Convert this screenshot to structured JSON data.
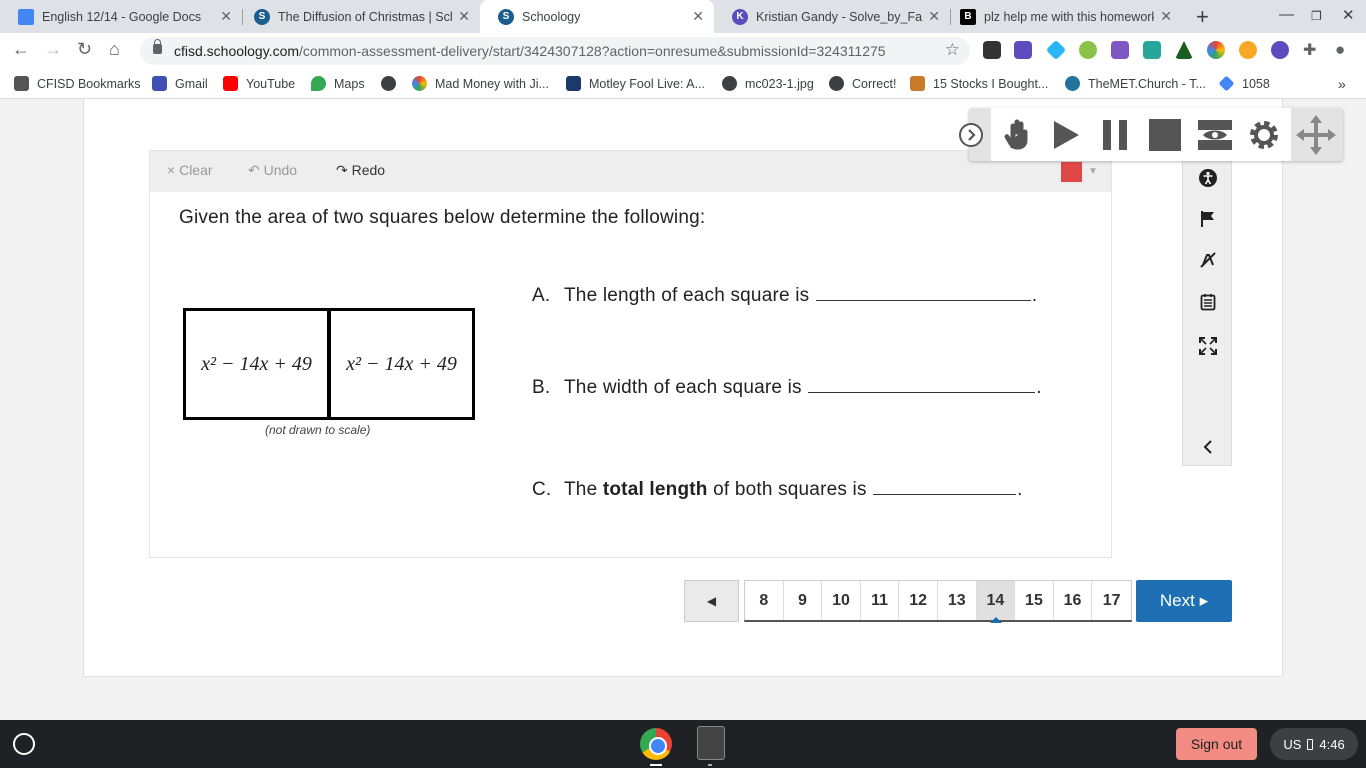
{
  "browser": {
    "tabs": [
      {
        "title": "English 12/14 - Google Docs",
        "favicon": "docs-icon",
        "color": "#4285f4"
      },
      {
        "title": "The Diffusion of Christmas | Sch",
        "favicon": "schoology-icon",
        "color": "#1a5e8f"
      },
      {
        "title": "Schoology",
        "favicon": "schoology-icon",
        "color": "#1a5e8f"
      },
      {
        "title": "Kristian Gandy - Solve_by_Facto",
        "favicon": "kami-icon",
        "color": "#5b4dbd"
      },
      {
        "title": "plz help me with this homework",
        "favicon": "brainly-icon",
        "color": "#000000"
      }
    ],
    "url_host": "cfisd.schoology.com",
    "url_path": "/common-assessment-delivery/start/3424307128?action=onresume&submissionId=324311275",
    "bookmarks": [
      "CFISD Bookmarks",
      "Gmail",
      "YouTube",
      "Maps",
      "Mad Money with Ji...",
      "Motley Fool Live: A...",
      "mc023-1.jpg",
      "Correct!",
      "15 Stocks I Bought...",
      "TheMET.Church - T...",
      "1058"
    ]
  },
  "question": {
    "toolbar": {
      "clear": "Clear",
      "undo": "Undo",
      "redo": "Redo"
    },
    "prompt": "Given the area of two squares below determine the following:",
    "square_expr": "x² − 14x + 49",
    "caption": "(not drawn to scale)",
    "items": [
      {
        "letter": "A.",
        "text": "The length of each square is"
      },
      {
        "letter": "B.",
        "text": "The width of each square is"
      },
      {
        "letter": "C.",
        "text_before": "The",
        "bold": "total length",
        "text_after": "of both squares is"
      }
    ]
  },
  "pager": {
    "prev": "◀",
    "pages": [
      "8",
      "9",
      "10",
      "11",
      "12",
      "13",
      "14",
      "15",
      "16",
      "17"
    ],
    "current": "14",
    "next": "Next ▸"
  },
  "shelf": {
    "signout": "Sign out",
    "locale": "US",
    "time": "4:46"
  },
  "colors": {
    "accent": "#1f6fb5",
    "swatch": "#e04848"
  }
}
